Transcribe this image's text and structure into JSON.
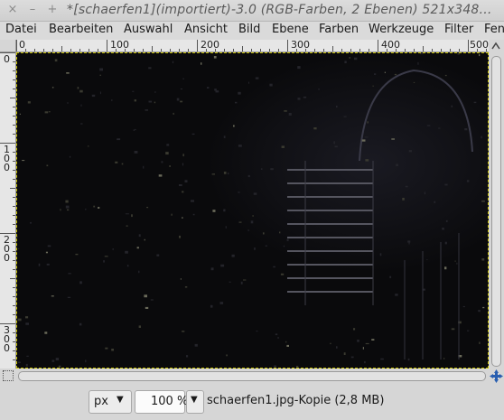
{
  "window": {
    "title": "*[schaerfen1](importiert)-3.0 (RGB-Farben, 2 Ebenen) 521x348…",
    "close_glyph": "×",
    "minimize_glyph": "–",
    "maximize_glyph": "+"
  },
  "menubar": {
    "items": [
      "Datei",
      "Bearbeiten",
      "Auswahl",
      "Ansicht",
      "Bild",
      "Ebene",
      "Farben",
      "Werkzeuge",
      "Filter",
      "Fen"
    ]
  },
  "ruler": {
    "h_labels": [
      "0",
      "100",
      "200",
      "300",
      "400",
      "500"
    ],
    "v_labels": [
      "0",
      "100",
      "200",
      "300"
    ]
  },
  "statusbar": {
    "unit": "px",
    "zoom": "100 %",
    "info": "schaerfen1.jpg-Kopie (2,8 MB)"
  },
  "icons": {
    "menu_arrow": "triangle-down-icon",
    "navigate": "navigate-icon",
    "quick_mask": "quick-mask-icon"
  },
  "colors": {
    "canvas_bg": "#0a0a0c",
    "layer_border": "#c8c000"
  }
}
